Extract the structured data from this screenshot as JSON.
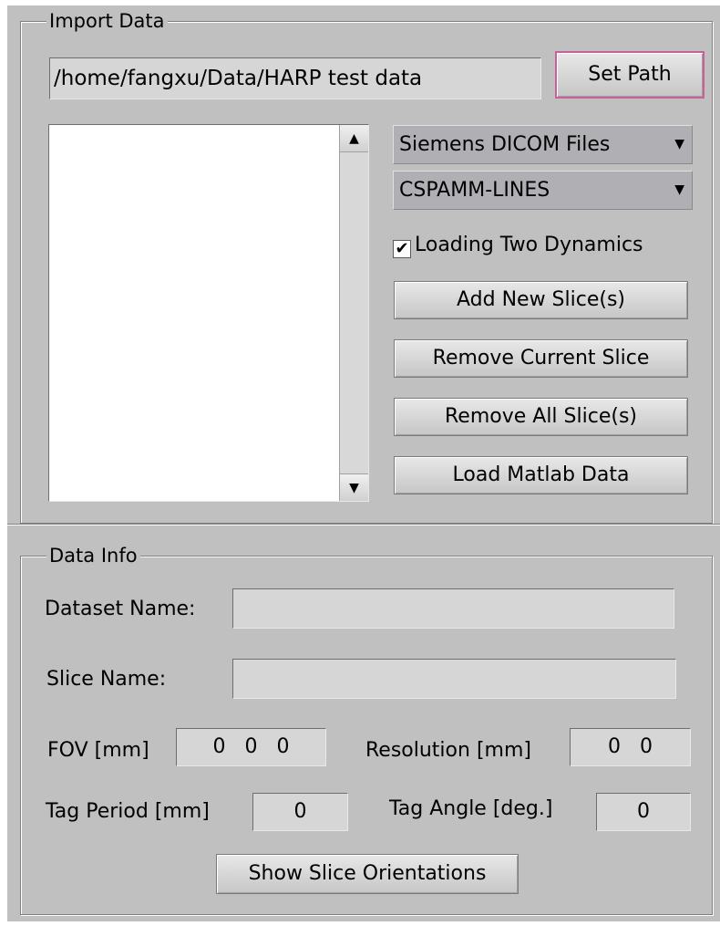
{
  "import_data": {
    "title": "Import Data",
    "path_value": "/home/fangxu/Data/HARP test data",
    "set_path_label": "Set Path",
    "file_type_selected": "Siemens DICOM Files",
    "sequence_selected": "CSPAMM-LINES",
    "loading_two_dynamics_label": "Loading Two Dynamics",
    "loading_two_dynamics_checked": true,
    "add_slice_label": "Add New Slice(s)",
    "remove_current_label": "Remove Current Slice",
    "remove_all_label": "Remove All Slice(s)",
    "load_matlab_label": "Load Matlab Data"
  },
  "data_info": {
    "title": "Data Info",
    "dataset_name_label": "Dataset Name:",
    "dataset_name_value": "",
    "slice_name_label": "Slice Name:",
    "slice_name_value": "",
    "fov_label": "FOV [mm]",
    "fov_value": "0   0   0",
    "resolution_label": "Resolution [mm]",
    "resolution_value": "0   0",
    "tag_period_label": "Tag Period [mm]",
    "tag_period_value": "0",
    "tag_angle_label": "Tag Angle [deg.]",
    "tag_angle_value": "0",
    "show_orientations_label": "Show Slice Orientations"
  },
  "icons": {
    "scroll_up": "triangle-up-icon",
    "scroll_down": "triangle-down-icon",
    "dropdown": "triangle-down-icon",
    "check": "checkmark-icon"
  }
}
